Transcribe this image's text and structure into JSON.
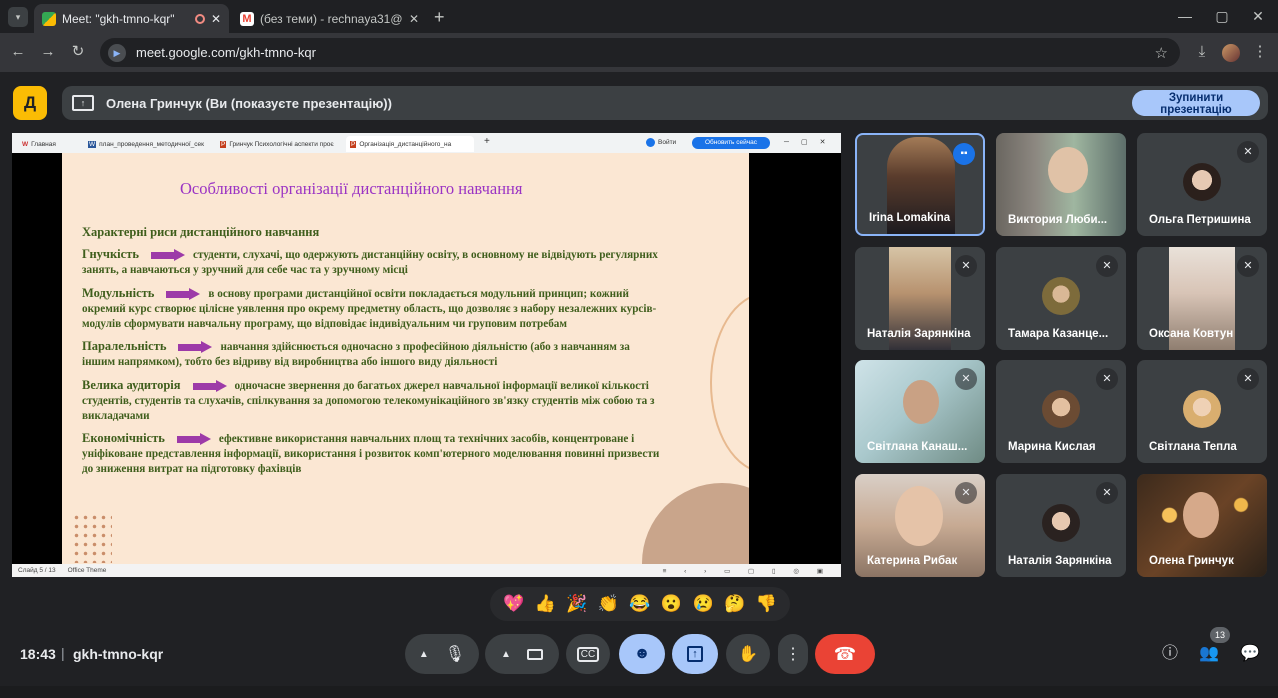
{
  "browser": {
    "tabs": [
      {
        "title": "Meet: \"gkh-tmno-kqr\"",
        "active": true
      },
      {
        "title": "(без теми) - rechnaya31@gmail",
        "active": false
      }
    ],
    "new_tab": "+",
    "url": "meet.google.com/gkh-tmno-kqr"
  },
  "meet": {
    "presenter_banner": "Олена Гринчук (Ви (показуєте презентацію))",
    "stop_button": "Зупинити презентацію",
    "clock": "18:43",
    "separator": "|",
    "meeting_code": "gkh-tmno-kqr",
    "participant_count": "13"
  },
  "shared_screen": {
    "inner_tabs": [
      "Главная",
      "план_проведення_методичної_сек",
      "Гринчук Психологічні аспекти проє",
      "Організація_дистанційного_на"
    ],
    "inner_login": "Войти",
    "inner_update": "Обновить сейчас",
    "slide": {
      "title": "Особливості організації дистанційного навчання",
      "subtitle": "Характерні риси дистанційного навчання",
      "items": [
        {
          "keyword": "Гнучкість",
          "text": "студенти, слухачі, що одержують дистанційну освіту, в основному не відвідують регулярних",
          "text2": "занять, а навчаються у зручний для себе час та у зручному місці"
        },
        {
          "keyword": "Модульність",
          "text": "в основу програми дистанційної освіти покладається модульний принцип; кожний",
          "text2": "окремий курс створює цілісне уявлення про окрему предметну область, що дозволяє з набору незалежних курсів-",
          "text3": "модулів сформувати навчальну програму, що відповідає індивідуальним чи груповим потребам"
        },
        {
          "keyword": "Паралельність",
          "text": "навчання здійснюється одночасно з професійною діяльністю (або з навчанням за",
          "text2": "іншим напрямком), тобто без відриву від виробництва або іншого виду діяльності"
        },
        {
          "keyword": "Велика аудиторія",
          "text": "одночасне звернення до багатьох джерел навчальної інформації великої кількості",
          "text2": "студентів, студентів та слухачів, спілкування за допомогою телекомунікаційного зв'язку студентів між собою та з",
          "text3": "викладачами"
        },
        {
          "keyword": "Економічність",
          "text": "ефективне використання навчальних площ та технічних засобів, концентроване і",
          "text2": "уніфіковане представлення інформації, використання і розвиток комп'ютерного моделювання повинні призвести",
          "text3": "до зниження витрат на підготовку фахівців"
        }
      ]
    },
    "status_slide": "Слайд 5 / 13",
    "status_theme": "Office Theme"
  },
  "participants": [
    {
      "name": "Irina Lomakina",
      "speaking": true
    },
    {
      "name": "Виктория Люби..."
    },
    {
      "name": "Ольга Петришина"
    },
    {
      "name": "Наталія Зарянкіна"
    },
    {
      "name": "Тамара Казанце..."
    },
    {
      "name": "Оксана Ковтун"
    },
    {
      "name": "Світлана Канаш..."
    },
    {
      "name": "Марина Кислая"
    },
    {
      "name": "Світлана Тепла"
    },
    {
      "name": "Катерина Рибак"
    },
    {
      "name": "Наталія Зарянкіна"
    },
    {
      "name": "Олена Гринчук"
    }
  ],
  "reactions": [
    "💖",
    "👍",
    "🎉",
    "👏",
    "😂",
    "😮",
    "😢",
    "🤔",
    "👎"
  ],
  "colors": {
    "accent": "#a8c7fa",
    "end_call": "#ea4335",
    "slide_bg": "#fbe7d3",
    "slide_title": "#9b34c4",
    "slide_text": "#3f5e1c",
    "arrow": "#9d3aa8"
  }
}
